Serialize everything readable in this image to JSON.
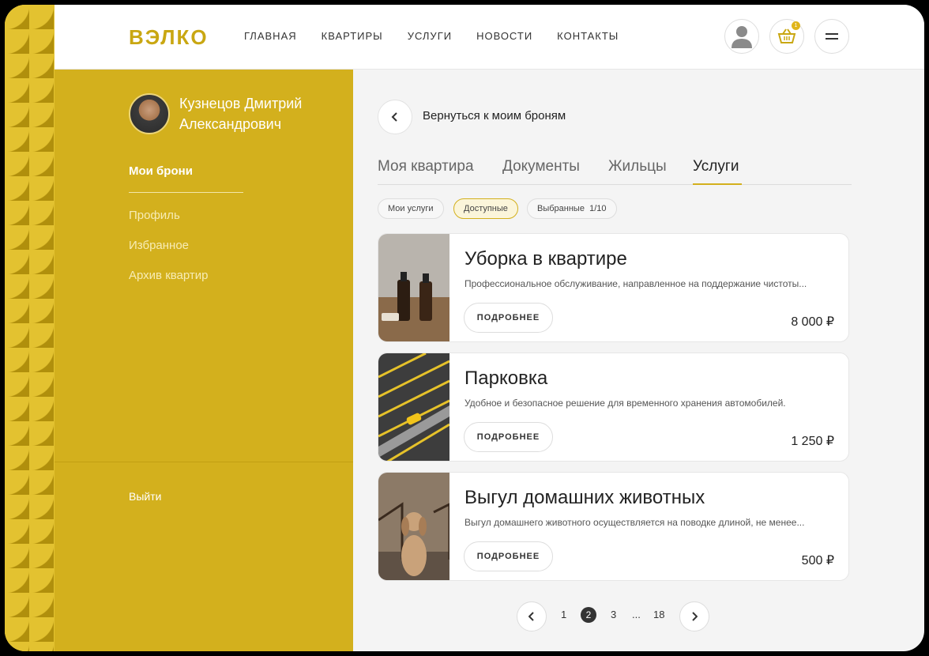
{
  "header": {
    "logo": "ВЭЛКО",
    "nav": [
      "ГЛАВНАЯ",
      "КВАРТИРЫ",
      "УСЛУГИ",
      "НОВОСТИ",
      "КОНТАКТЫ"
    ],
    "cart_count": "1"
  },
  "sidebar": {
    "user_name": "Кузнецов Дмитрий Александрович",
    "active_item": "Мои брони",
    "items": [
      "Профиль",
      "Избранное",
      "Архив квартир"
    ],
    "logout": "Выйти"
  },
  "main": {
    "back_label": "Вернуться к моим броням",
    "tabs": [
      "Моя квартира",
      "Документы",
      "Жильцы",
      "Услуги"
    ],
    "filters": [
      "Мои услуги",
      "Доступные",
      "Выбранные",
      "1/10"
    ],
    "more_label": "ПОДРОБНЕЕ",
    "services": [
      {
        "title": "Уборка в квартире",
        "description": "Профессиональное обслуживание, направленное на поддержание чистоты...",
        "price": "8 000 ₽"
      },
      {
        "title": "Парковка",
        "description": "Удобное и безопасное решение для временного хранения автомобилей.",
        "price": "1 250 ₽"
      },
      {
        "title": "Выгул домашних животных",
        "description": "Выгул домашнего животного осуществляется на поводке длиной, не менее...",
        "price": "500 ₽"
      }
    ],
    "pagination": [
      "1",
      "2",
      "3",
      "...",
      "18"
    ]
  },
  "colors": {
    "accent": "#d3b01d",
    "logo": "#c9a712"
  }
}
